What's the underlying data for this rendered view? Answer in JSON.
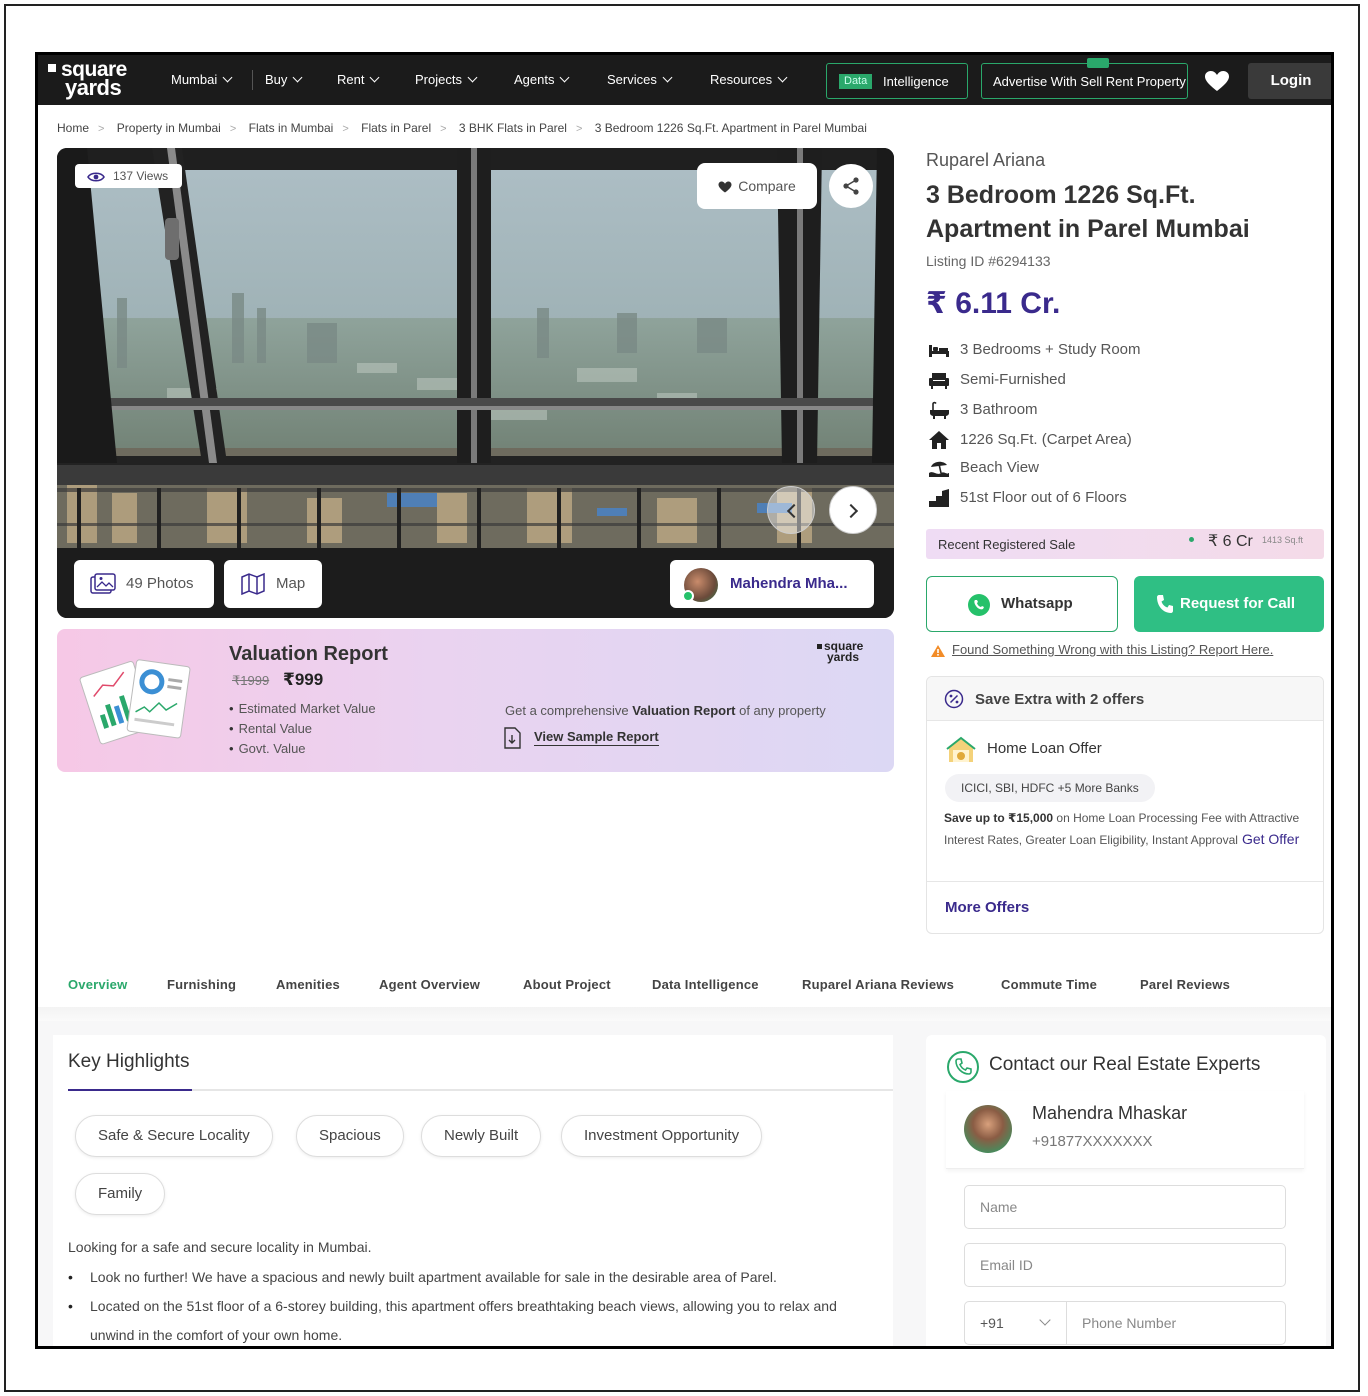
{
  "nav": {
    "logo_line1": "square",
    "logo_line2": "yards",
    "city": "Mumbai",
    "items": [
      "Buy",
      "Rent",
      "Projects",
      "Agents",
      "Services",
      "Resources"
    ],
    "data_tag": "Data",
    "data_label": "Intelligence",
    "post_property": "Advertise With Sell Rent Property",
    "login": "Login",
    "accent": "#2aa86b"
  },
  "breadcrumb": [
    "Home",
    "Property in Mumbai",
    "Flats in Mumbai",
    "Flats in Parel",
    "3 BHK Flats in Parel",
    "3 Bedroom 1226 Sq.Ft. Apartment in Parel Mumbai"
  ],
  "gallery": {
    "views": "137 Views",
    "compare": "Compare",
    "photos": "49 Photos",
    "map": "Map",
    "agent_chip": "Mahendra Mha..."
  },
  "valuation": {
    "title": "Valuation Report",
    "old_price": "₹1999",
    "new_price": "₹999",
    "features": [
      "Estimated Market Value",
      "Rental Value",
      "Govt. Value"
    ],
    "logo_line1": "square",
    "logo_line2": "yards",
    "desc_pre": "Get a comprehensive ",
    "desc_bold": "Valuation Report",
    "desc_post": " of any property",
    "sample_link": "View Sample Report"
  },
  "property": {
    "project": "Ruparel Ariana",
    "title": "3 Bedroom 1226 Sq.Ft. Apartment in Parel Mumbai",
    "listing_id": "Listing ID #6294133",
    "price": "₹ 6.11 Cr.",
    "price_color": "#3a2a8c",
    "features": [
      {
        "icon": "bed-icon",
        "text": "3 Bedrooms + Study Room"
      },
      {
        "icon": "sofa-icon",
        "text": "Semi-Furnished"
      },
      {
        "icon": "bathtub-icon",
        "text": "3 Bathroom"
      },
      {
        "icon": "home-icon",
        "text": "1226 Sq.Ft. (Carpet Area)"
      },
      {
        "icon": "beach-icon",
        "text": "Beach View"
      },
      {
        "icon": "building-floor-icon",
        "text": "51st Floor out of 6 Floors"
      }
    ]
  },
  "recent_sale": {
    "label": "Recent Registered Sale",
    "value": "₹ 6 Cr",
    "area": "1413 Sq.ft"
  },
  "actions": {
    "whatsapp": "Whatsapp",
    "call": "Request for Call",
    "report": "Found Something Wrong with this Listing? Report Here."
  },
  "offers": {
    "header": "Save Extra with 2 offers",
    "home_loan_title": "Home Loan Offer",
    "banks": "ICICI, SBI, HDFC +5 More Banks",
    "desc_bold": "Save up to ₹15,000",
    "desc_rest": " on Home Loan Processing Fee with Attractive Interest Rates, Greater Loan Eligibility, Instant Approval",
    "get_offer": "Get Offer",
    "more_offers": "More Offers"
  },
  "tabs": [
    "Overview",
    "Furnishing",
    "Amenities",
    "Agent Overview",
    "About Project",
    "Data Intelligence",
    "Ruparel Ariana Reviews",
    "Commute Time",
    "Parel Reviews"
  ],
  "highlights": {
    "title": "Key Highlights",
    "chips": [
      "Safe & Secure Locality",
      "Spacious",
      "Newly Built",
      "Investment Opportunity",
      "Family"
    ],
    "intro": "Looking for a safe and secure locality in Mumbai.",
    "points": [
      "Look no further! We have a spacious and newly built apartment available for sale in the desirable area of Parel.",
      "Located on the 51st floor of a 6-storey building, this apartment offers breathtaking beach views, allowing you to relax and unwind in the comfort of your own home."
    ]
  },
  "contact": {
    "title": "Contact our Real Estate Experts",
    "agent_name": "Mahendra Mhaskar",
    "agent_phone": "+91877XXXXXXX",
    "name_placeholder": "Name",
    "email_placeholder": "Email ID",
    "country_code": "+91",
    "phone_placeholder": "Phone Number"
  }
}
